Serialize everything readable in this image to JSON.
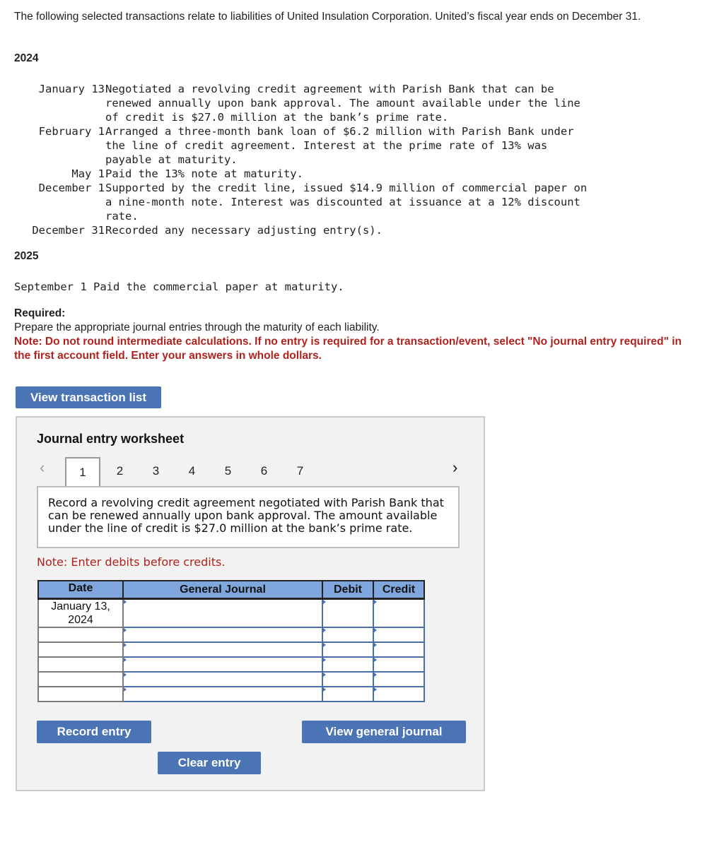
{
  "intro": "The following selected transactions relate to liabilities of United Insulation Corporation. United’s fiscal year ends on December 31.",
  "years": [
    "2024",
    "2025"
  ],
  "transactions_2024": [
    {
      "date": "January 13",
      "text": "Negotiated a revolving credit agreement with Parish Bank that can be\nrenewed annually upon bank approval. The amount available under the line\nof credit is $27.0 million at the bank’s prime rate."
    },
    {
      "date": "February 1",
      "text": "Arranged a three-month bank loan of $6.2 million with Parish Bank under\nthe line of credit agreement. Interest at the prime rate of 13% was\npayable at maturity."
    },
    {
      "date": "May 1",
      "text": "Paid the 13% note at maturity."
    },
    {
      "date": "December 1",
      "text": "Supported by the credit line, issued $14.9 million of commercial paper on\na nine-month note. Interest was discounted at issuance at a 12% discount\nrate."
    },
    {
      "date": "December 31",
      "text": "Recorded any necessary adjusting entry(s)."
    }
  ],
  "transactions_2025": [
    {
      "date": "September 1",
      "text": "Paid the commercial paper at maturity."
    }
  ],
  "required": {
    "title": "Required:",
    "text": "Prepare the appropriate journal entries through the maturity of each liability.",
    "note": "Note: Do not round intermediate calculations. If no entry is required for a transaction/event, select \"No journal entry required\" in the first account field. Enter your answers in whole dollars."
  },
  "buttons": {
    "view_transaction_list": "View transaction list",
    "record_entry": "Record entry",
    "view_general_journal": "View general journal",
    "clear_entry": "Clear entry"
  },
  "worksheet": {
    "title": "Journal entry worksheet",
    "prev_icon": "‹",
    "next_icon": "›",
    "tabs": [
      "1",
      "2",
      "3",
      "4",
      "5",
      "6",
      "7"
    ],
    "active_tab": "1",
    "description": "Record a revolving credit agreement negotiated with Parish Bank that can be renewed annually upon bank approval. The amount available under the line of credit is $27.0 million at the bank’s prime rate.",
    "note": "Note: Enter debits before credits.",
    "columns": [
      "Date",
      "General Journal",
      "Debit",
      "Credit"
    ],
    "rows": [
      {
        "date": "January 13, 2024",
        "account": "",
        "debit": "",
        "credit": ""
      },
      {
        "date": "",
        "account": "",
        "debit": "",
        "credit": ""
      },
      {
        "date": "",
        "account": "",
        "debit": "",
        "credit": ""
      },
      {
        "date": "",
        "account": "",
        "debit": "",
        "credit": ""
      },
      {
        "date": "",
        "account": "",
        "debit": "",
        "credit": ""
      },
      {
        "date": "",
        "account": "",
        "debit": "",
        "credit": ""
      }
    ]
  },
  "colors": {
    "button_blue": "#4a74b4",
    "header_blue": "#7fa7dd",
    "note_red": "#b0221e"
  }
}
